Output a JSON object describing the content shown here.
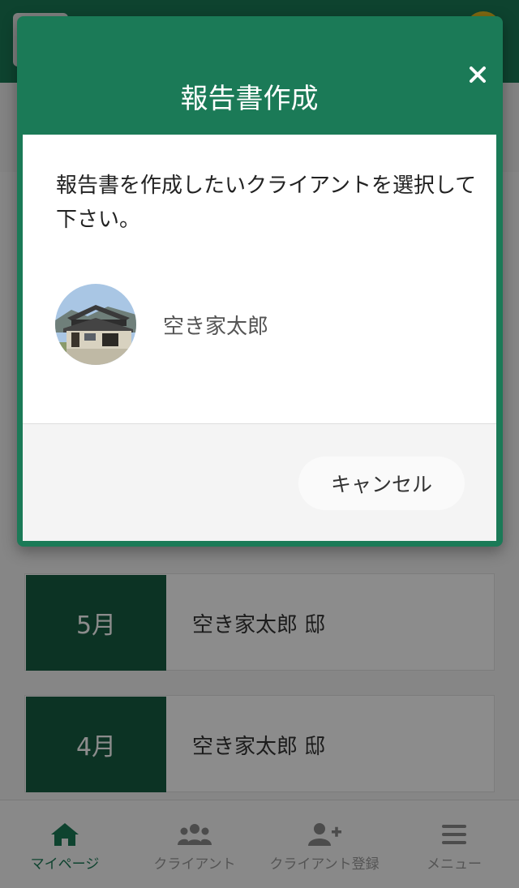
{
  "modal": {
    "title": "報告書作成",
    "message": "報告書を作成したいクライアントを選択して下さい。",
    "client_name": "空き家太郎",
    "cancel_label": "キャンセル"
  },
  "reports": [
    {
      "month": "5月",
      "label": "空き家太郎 邸"
    },
    {
      "month": "4月",
      "label": "空き家太郎 邸"
    }
  ],
  "bottom_nav": [
    {
      "label": "マイページ",
      "icon": "home-icon",
      "active": true
    },
    {
      "label": "クライアント",
      "icon": "users-icon",
      "active": false
    },
    {
      "label": "クライアント登録",
      "icon": "user-plus-icon",
      "active": false
    },
    {
      "label": "メニュー",
      "icon": "menu-icon",
      "active": false
    }
  ],
  "colors": {
    "brand_green": "#1b7a57",
    "dark_green": "#175e43",
    "avatar_yellow": "#e8c020"
  }
}
